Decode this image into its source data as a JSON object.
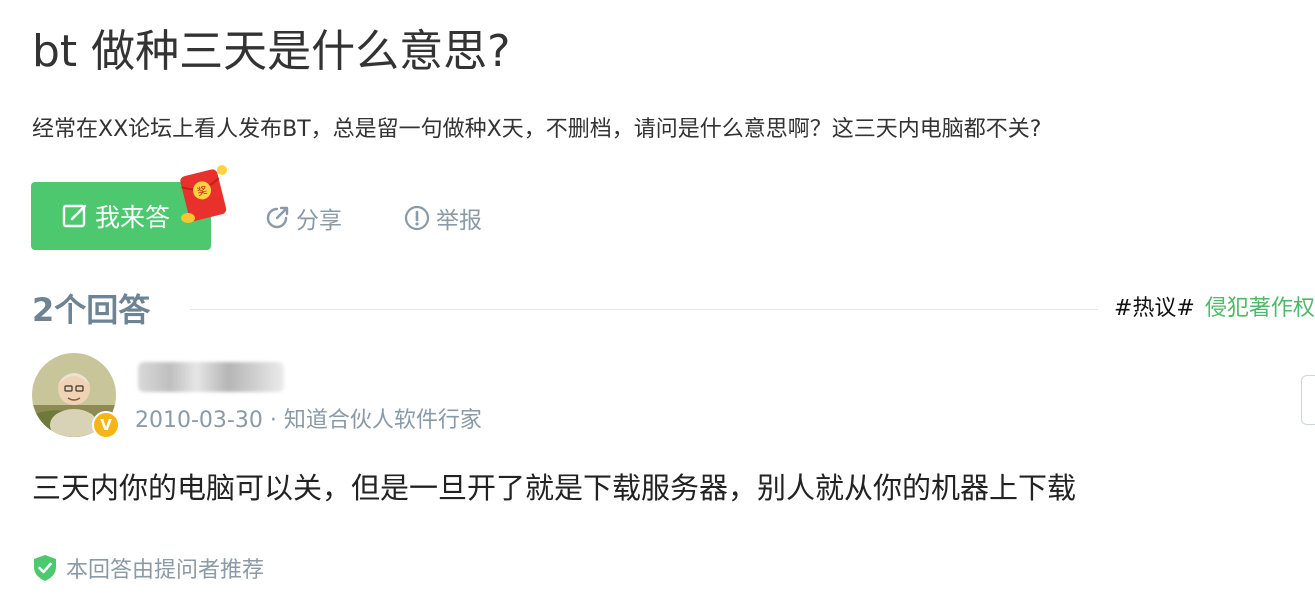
{
  "question": {
    "title": "bt 做种三天是什么意思?",
    "description": "经常在XX论坛上看人发布BT，总是留一句做种X天，不删档，请问是什么意思啊？这三天内电脑都不关?"
  },
  "actions": {
    "answer_label": "我来答",
    "answer_icon": "edit-icon",
    "reward_badge_text": "奖",
    "share_label": "分享",
    "share_icon": "share-icon",
    "report_label": "举报",
    "report_icon": "report-icon"
  },
  "answers_header": {
    "count_label": "2个回答",
    "hot_hash": "#热议#",
    "hot_link": "侵犯著作权"
  },
  "answer": {
    "author_name_hidden": true,
    "verified_badge": "V",
    "meta": "2010-03-30 · 知道合伙人软件行家",
    "content": "三天内你的电脑可以关，但是一旦开了就是下载服务器，别人就从你的机器上下载",
    "recommended_label": "本回答由提问者推荐",
    "recommended_icon": "shield-check-icon"
  },
  "colors": {
    "accent_green": "#4dc86f",
    "muted_text": "#8a9aa6",
    "badge_gold": "#f5b418",
    "header_gray": "#6e8494"
  }
}
